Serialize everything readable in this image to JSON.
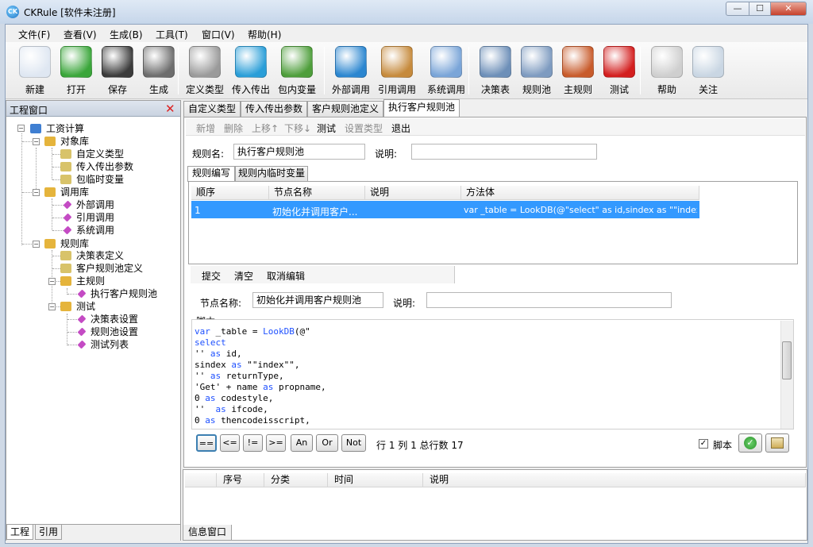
{
  "window": {
    "title": "CKRule [软件未注册]",
    "app_icon": "CK",
    "min": "—",
    "max": "☐",
    "close": "✕"
  },
  "menu": [
    "文件(F)",
    "查看(V)",
    "生成(B)",
    "工具(T)",
    "窗口(V)",
    "帮助(H)"
  ],
  "toolbar": [
    {
      "label": "新建",
      "icon": "new-document-icon",
      "color": "#dfe7f2"
    },
    {
      "label": "打开",
      "icon": "green-arrow-open-icon",
      "color": "#3aa63a"
    },
    {
      "label": "保存",
      "icon": "floppy-disk-icon",
      "color": "#3b3b3b"
    },
    {
      "label": "生成",
      "icon": "tools-build-icon",
      "color": "#6d6d6d"
    },
    {
      "label": "定义类型",
      "icon": "define-type-icon",
      "color": "#9a9a9a"
    },
    {
      "label": "传入传出",
      "icon": "in-out-arrows-icon",
      "color": "#2a9ed8"
    },
    {
      "label": "包内变量",
      "icon": "package-variable-icon",
      "color": "#4e9e3b"
    },
    {
      "label": "外部调用",
      "icon": "external-call-gear-icon",
      "color": "#2b86d0"
    },
    {
      "label": "引用调用",
      "icon": "reference-call-box-icon",
      "color": "#c68a3c"
    },
    {
      "label": "系统调用",
      "icon": "system-call-search-icon",
      "color": "#7aa5d8"
    },
    {
      "label": "决策表",
      "icon": "decision-table-icon",
      "color": "#6d8fb8"
    },
    {
      "label": "规则池",
      "icon": "rule-pool-icon",
      "color": "#7e9bc0"
    },
    {
      "label": "主规则",
      "icon": "main-rule-icon",
      "color": "#c85b2b"
    },
    {
      "label": "测试",
      "icon": "ladybug-test-icon",
      "color": "#d31e1e"
    },
    {
      "label": "帮助",
      "icon": "help-question-icon",
      "color": "#cfcfcf"
    },
    {
      "label": "关注",
      "icon": "follow-chat-icon",
      "color": "#c9d6e3"
    }
  ],
  "left_panel": {
    "title": "工程窗口",
    "tree": {
      "root": "工资计算",
      "object_lib": "对象库",
      "object_items": [
        "自定义类型",
        "传入传出参数",
        "包临时变量"
      ],
      "call_lib": "调用库",
      "call_items": [
        "外部调用",
        "引用调用",
        "系统调用"
      ],
      "rule_lib": "规则库",
      "rule_items": [
        "决策表定义",
        "客户规则池定义"
      ],
      "main_rule": "主规则",
      "main_rule_items": [
        "执行客户规则池"
      ],
      "test": "测试",
      "test_items": [
        "决策表设置",
        "规则池设置",
        "测试列表"
      ]
    },
    "tabs": [
      "工程",
      "引用"
    ]
  },
  "doc_tabs": [
    "自定义类型",
    "传入传出参数",
    "客户规则池定义",
    "执行客户规则池"
  ],
  "sub_toolbar": [
    {
      "label": "新增",
      "enabled": false
    },
    {
      "label": "删除",
      "enabled": false
    },
    {
      "label": "上移↑",
      "enabled": false
    },
    {
      "label": "下移↓",
      "enabled": false
    },
    {
      "label": "测试",
      "enabled": true
    },
    {
      "label": "设置类型",
      "enabled": false
    },
    {
      "label": "退出",
      "enabled": true
    }
  ],
  "rule_form": {
    "name_label": "规则名:",
    "name_value": "执行客户规则池",
    "desc_label": "说明:",
    "desc_value": ""
  },
  "inner_tabs": [
    "规则编写",
    "规则内临时变量"
  ],
  "grid": {
    "headers": [
      "顺序",
      "节点名称",
      "说明",
      "方法体"
    ],
    "rows": [
      {
        "order": "1",
        "name": "初始化并调用客户...",
        "desc": "",
        "body": "var _table = LookDB(@\"select\" as id,sindex as \"\"index\"\",\" ..."
      }
    ]
  },
  "edit_toolbar": [
    "提交",
    "清空",
    "取消编辑"
  ],
  "node_form": {
    "name_label": "节点名称:",
    "name_value": "初始化并调用客户规则池",
    "desc_label": "说明:",
    "desc_value": ""
  },
  "script": {
    "label": "脚本",
    "lines": [
      [
        {
          "t": "var",
          "k": 1
        },
        {
          "t": " _table = "
        },
        {
          "t": "LookDB",
          "k": 1
        },
        {
          "t": "(@\""
        }
      ],
      [
        {
          "t": "select",
          "k": 1
        }
      ],
      [
        {
          "t": "'' "
        },
        {
          "t": "as",
          "k": 1
        },
        {
          "t": " id,"
        }
      ],
      [
        {
          "t": "sindex "
        },
        {
          "t": "as",
          "k": 1
        },
        {
          "t": " \"\"index\"\","
        }
      ],
      [
        {
          "t": "'' "
        },
        {
          "t": "as",
          "k": 1
        },
        {
          "t": " returnType,"
        }
      ],
      [
        {
          "t": "'Get' + name "
        },
        {
          "t": "as",
          "k": 1
        },
        {
          "t": " propname,"
        }
      ],
      [
        {
          "t": "0 "
        },
        {
          "t": "as",
          "k": 1
        },
        {
          "t": " codestyle,"
        }
      ],
      [
        {
          "t": "''  "
        },
        {
          "t": "as",
          "k": 1
        },
        {
          "t": " ifcode,"
        }
      ],
      [
        {
          "t": "0 "
        },
        {
          "t": "as",
          "k": 1
        },
        {
          "t": " thencodeisscript,"
        }
      ]
    ]
  },
  "operators": [
    "==",
    "<=",
    "!=",
    ">=",
    "An",
    "Or",
    "Not"
  ],
  "status": "行 1 列 1 总行数 17",
  "script_checkbox": {
    "label": "脚本",
    "checked": true
  },
  "info_panel": {
    "headers": [
      "序号",
      "分类",
      "时间",
      "说明"
    ],
    "tab": "信息窗口"
  }
}
